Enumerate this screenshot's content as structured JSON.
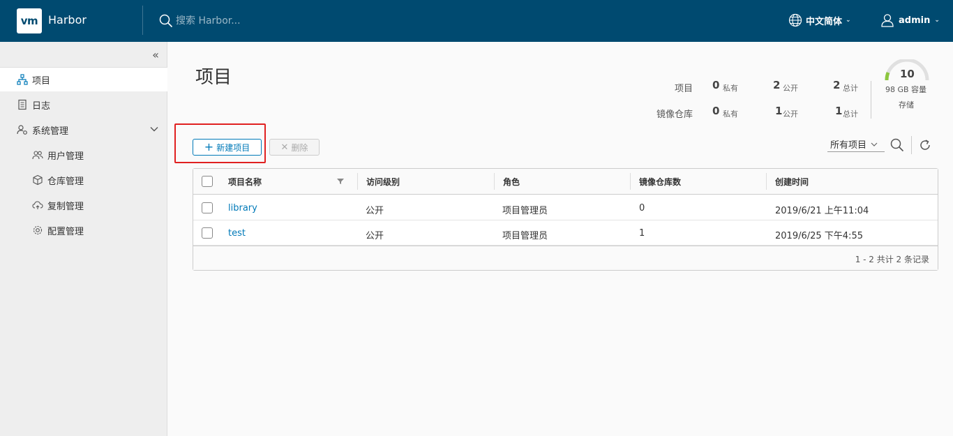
{
  "header": {
    "logo_text": "vm",
    "app_title": "Harbor",
    "search_placeholder": "搜索 Harbor...",
    "language": "中文简体",
    "user": "admin"
  },
  "sidebar": {
    "items": [
      {
        "label": "项目",
        "icon": "projects-icon",
        "active": true
      },
      {
        "label": "日志",
        "icon": "log-icon"
      },
      {
        "label": "系统管理",
        "icon": "admin-icon"
      },
      {
        "label": "用户管理",
        "icon": "users-icon"
      },
      {
        "label": "仓库管理",
        "icon": "registry-icon"
      },
      {
        "label": "复制管理",
        "icon": "replication-icon"
      },
      {
        "label": "配置管理",
        "icon": "config-icon"
      }
    ]
  },
  "main": {
    "title": "项目",
    "stats": {
      "projects_label": "项目",
      "repos_label": "镜像仓库",
      "private_label": "私有",
      "public_label": "公开",
      "total_label": "总计",
      "projects": {
        "private": "0",
        "public": "2",
        "total": "2"
      },
      "repos": {
        "private": "0",
        "public": "1",
        "total": "1"
      }
    },
    "storage": {
      "value": "10",
      "capacity": "98 GB 容量",
      "label": "存储"
    },
    "toolbar": {
      "new_project": "新建项目",
      "delete": "删除",
      "filter": "所有项目"
    },
    "table": {
      "columns": [
        "项目名称",
        "访问级别",
        "角色",
        "镜像仓库数",
        "创建时间"
      ],
      "rows": [
        {
          "name": "library",
          "access": "公开",
          "role": "项目管理员",
          "repos": "0",
          "created": "2019/6/21 上午11:04"
        },
        {
          "name": "test",
          "access": "公开",
          "role": "项目管理员",
          "repos": "1",
          "created": "2019/6/25 下午4:55"
        }
      ],
      "footer": "1 - 2 共计 2 条记录"
    }
  },
  "colors": {
    "header_bg": "#004a70",
    "accent": "#0079b8",
    "highlight": "#e02020",
    "gauge": "#8cc63f"
  }
}
